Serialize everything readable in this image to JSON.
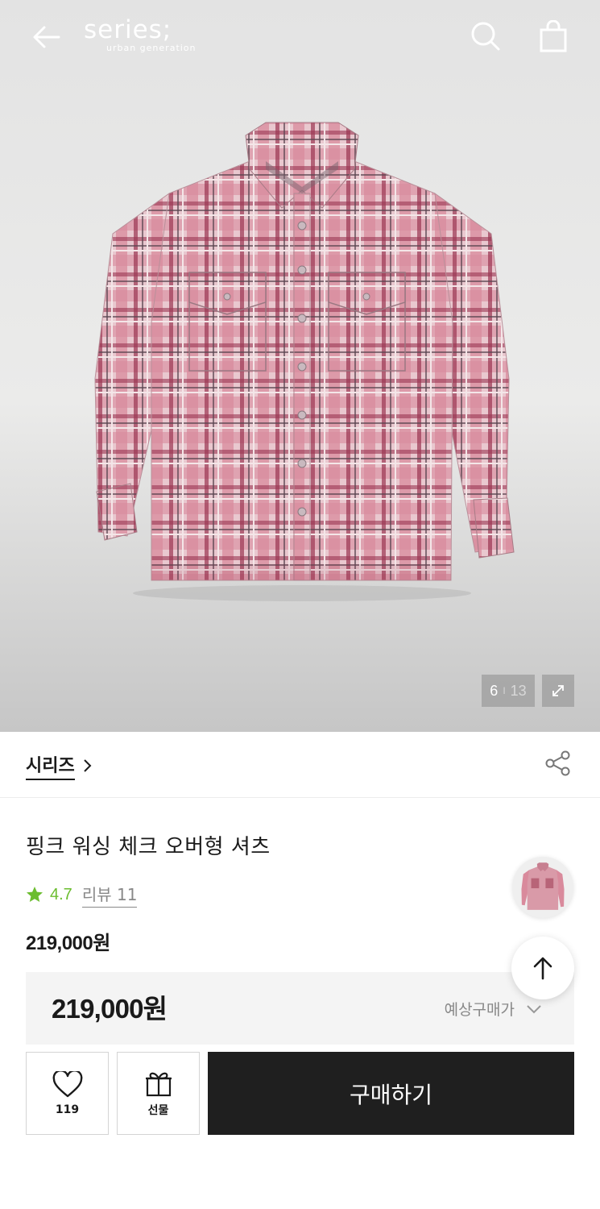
{
  "header": {
    "logo_text": "series;",
    "logo_tagline": "urban generation"
  },
  "gallery": {
    "current": "6",
    "separator": "I",
    "total": "13"
  },
  "brand": {
    "name": "시리즈"
  },
  "product": {
    "title": "핑크 워싱 체크 오버형 셔츠",
    "rating": "4.7",
    "review_label": "리뷰 11",
    "price": "219,000원",
    "expected_price": "219,000원",
    "expected_label": "예상구매가"
  },
  "actions": {
    "like_count": "119",
    "gift_label": "선물",
    "buy_label": "구매하기"
  },
  "colors": {
    "rating_star": "#6bbd2f",
    "buy_button_bg": "#1f1f1f",
    "shirt_pink": "#d98a9c",
    "shirt_wine": "#9b3552"
  },
  "icons": [
    "back-arrow-icon",
    "search-icon",
    "shopping-bag-icon",
    "expand-icon",
    "chevron-right-icon",
    "share-icon",
    "star-icon",
    "chevron-down-icon",
    "arrow-up-icon",
    "heart-icon",
    "gift-icon"
  ]
}
